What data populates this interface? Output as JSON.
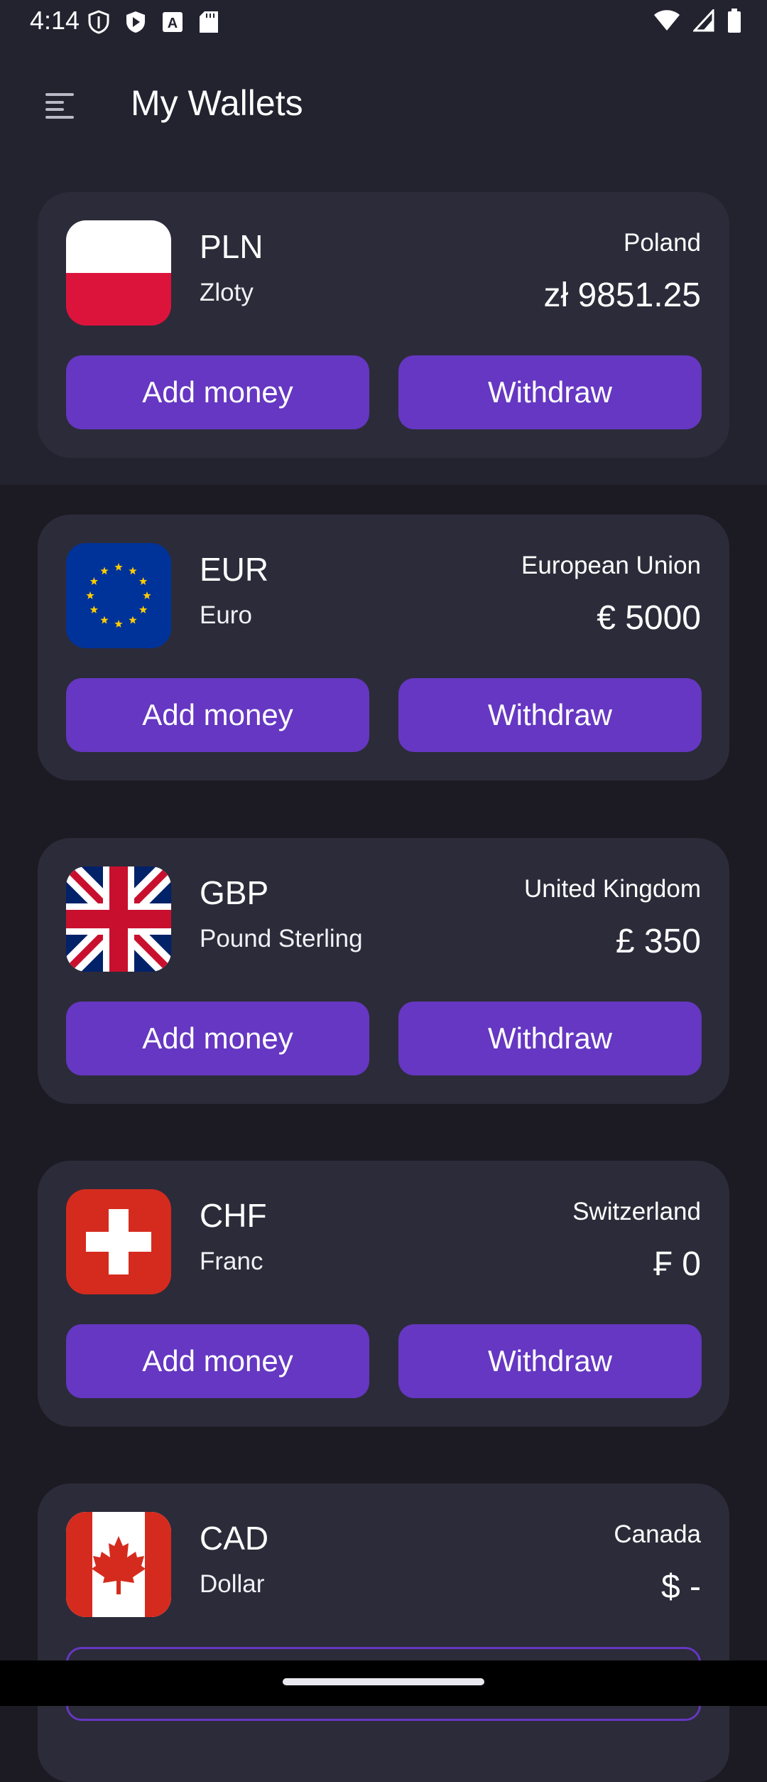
{
  "status_bar": {
    "time": "4:14",
    "left_icons": [
      "shield-icon",
      "play-store-icon",
      "text-a-icon",
      "sd-card-icon"
    ],
    "right_icons": [
      "wifi-icon",
      "signal-icon",
      "battery-icon"
    ]
  },
  "app_bar": {
    "title": "My Wallets",
    "menu_icon": "menu-icon"
  },
  "wallets": [
    {
      "code": "PLN",
      "name": "Zloty",
      "country": "Poland",
      "balance": "zł 9851.25",
      "add_label": "Add money",
      "withdraw_label": "Withdraw",
      "flag": "poland-flag"
    },
    {
      "code": "EUR",
      "name": "Euro",
      "country": "European Union",
      "balance": "€ 5000",
      "add_label": "Add money",
      "withdraw_label": "Withdraw",
      "flag": "eu-flag"
    },
    {
      "code": "GBP",
      "name": "Pound Sterling",
      "country": "United Kingdom",
      "balance": "£ 350",
      "add_label": "Add money",
      "withdraw_label": "Withdraw",
      "flag": "uk-flag"
    },
    {
      "code": "CHF",
      "name": "Franc",
      "country": "Switzerland",
      "balance": "₣ 0",
      "add_label": "Add money",
      "withdraw_label": "Withdraw",
      "flag": "switzerland-flag"
    },
    {
      "code": "CAD",
      "name": "Dollar",
      "country": "Canada",
      "balance": "$ -",
      "flag": "canada-flag"
    }
  ],
  "colors": {
    "background": "#1c1b24",
    "header": "#23222f",
    "card": "#2c2b39",
    "accent": "#6537c2"
  }
}
